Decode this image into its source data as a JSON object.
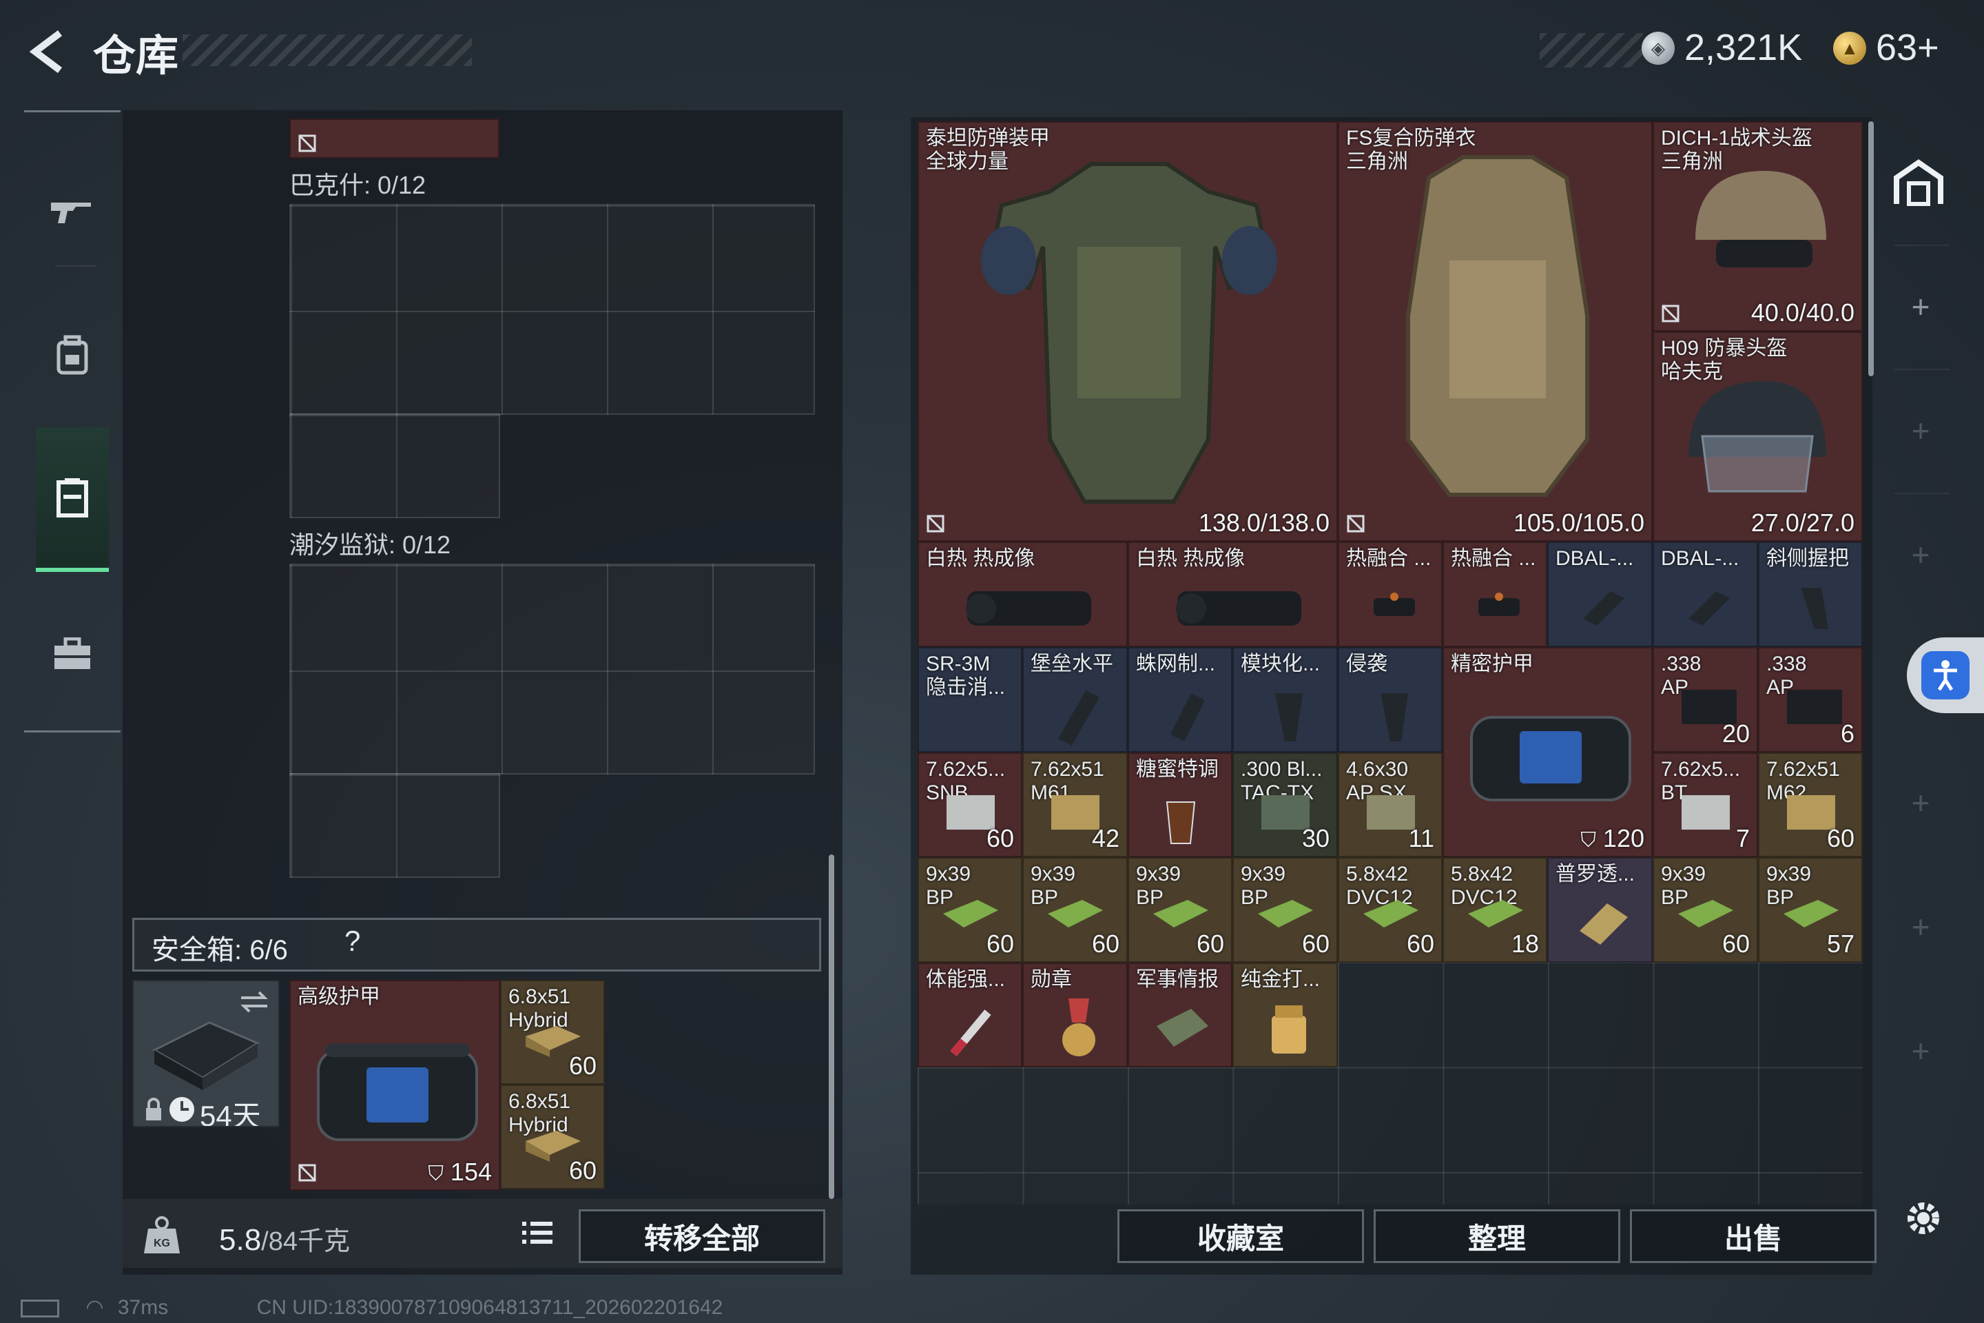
{
  "header": {
    "title": "仓库",
    "currency": [
      {
        "name": "silver-coin",
        "value": "2,321K",
        "color": "#c9d1d6"
      },
      {
        "name": "gold-coin",
        "value": "63+",
        "color": "#e0b040"
      }
    ]
  },
  "left_rail": {
    "items": [
      {
        "name": "weapon",
        "icon": "rifle-icon"
      },
      {
        "name": "backpack",
        "icon": "backpack-icon"
      },
      {
        "name": "storage",
        "icon": "storage-icon",
        "active": true
      },
      {
        "name": "briefcase",
        "icon": "briefcase-icon"
      }
    ]
  },
  "left_panel": {
    "top_label": "巴克什: 0/12",
    "mid_label": "潮汐监狱: 0/12",
    "safebox_label": "安全箱: 6/6",
    "safebox_help": "?",
    "safebox_case_time": "54天",
    "safebox_items": [
      {
        "name": "高级护甲",
        "value": "154"
      },
      {
        "name": "6.8x51",
        "sub": "Hybrid",
        "value": "60"
      },
      {
        "name": "6.8x51",
        "sub": "Hybrid",
        "value": "60"
      }
    ],
    "weight": "5.8",
    "weight_max": "/84千克",
    "transfer_all": "转移全部"
  },
  "right_panel": {
    "armor": [
      {
        "name": "泰坦防弹装甲",
        "sub": "全球力量",
        "value": "138.0/138.0"
      },
      {
        "name": "FS复合防弹衣",
        "sub": "三角洲",
        "value": "105.0/105.0"
      },
      {
        "name": "DICH-1战术头盔",
        "sub": "三角洲",
        "value": "40.0/40.0"
      },
      {
        "name": "H09 防暴头盔",
        "sub": "哈夫克",
        "value": "27.0/27.0"
      }
    ],
    "row1": [
      {
        "name": "白热 热成像"
      },
      {
        "name": "白热 热成像"
      },
      {
        "name": "热融合 ..."
      },
      {
        "name": "热融合 ..."
      },
      {
        "name": "DBAL-..."
      },
      {
        "name": "DBAL-..."
      },
      {
        "name": "斜侧握把"
      }
    ],
    "row2": [
      {
        "name": "SR-3M",
        "sub": "隐击消..."
      },
      {
        "name": "堡垒水平"
      },
      {
        "name": "蛛网制..."
      },
      {
        "name": "模块化..."
      },
      {
        "name": "侵袭"
      },
      {
        "name": "精密护甲",
        "value": "120"
      },
      {
        "name": ".338",
        "sub": "AP",
        "value": "20"
      },
      {
        "name": ".338",
        "sub": "AP",
        "value": "6"
      }
    ],
    "row3": [
      {
        "name": "7.62x5...",
        "sub": "SNB",
        "value": "60"
      },
      {
        "name": "7.62x51",
        "sub": "M61",
        "value": "42"
      },
      {
        "name": "糖蜜特调"
      },
      {
        "name": ".300 Bl...",
        "sub": "TAC-TX",
        "value": "30"
      },
      {
        "name": "4.6x30",
        "sub": "AP SX",
        "value": "11"
      },
      {
        "name": "7.62x5...",
        "sub": "BT",
        "value": "7"
      },
      {
        "name": "7.62x51",
        "sub": "M62",
        "value": "60"
      }
    ],
    "row4": [
      {
        "name": "9x39",
        "sub": "BP",
        "value": "60"
      },
      {
        "name": "9x39",
        "sub": "BP",
        "value": "60"
      },
      {
        "name": "9x39",
        "sub": "BP",
        "value": "60"
      },
      {
        "name": "9x39",
        "sub": "BP",
        "value": "60"
      },
      {
        "name": "5.8x42",
        "sub": "DVC12",
        "value": "60"
      },
      {
        "name": "5.8x42",
        "sub": "DVC12",
        "value": "18"
      },
      {
        "name": "普罗透..."
      },
      {
        "name": "9x39",
        "sub": "BP",
        "value": "60"
      },
      {
        "name": "9x39",
        "sub": "BP",
        "value": "57"
      }
    ],
    "row5": [
      {
        "name": "体能强..."
      },
      {
        "name": "勋章"
      },
      {
        "name": "军事情报"
      },
      {
        "name": "纯金打..."
      }
    ],
    "buttons": {
      "collection": "收藏室",
      "sort": "整理",
      "sell": "出售"
    }
  },
  "status": {
    "ping": "37ms",
    "uid": "CN UID:1839007871090648137​11_202602201642"
  }
}
